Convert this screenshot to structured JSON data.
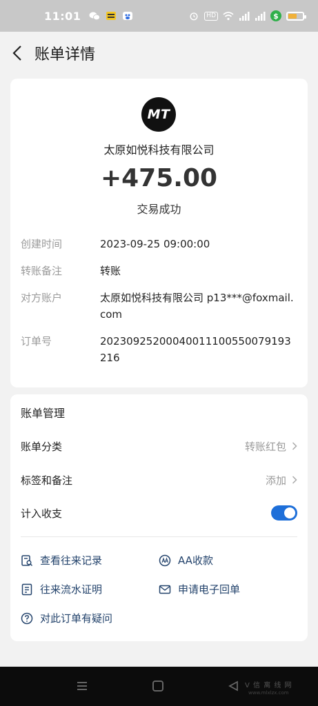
{
  "status_bar": {
    "time": "11:01",
    "left_icons": [
      "wechat-icon",
      "app-badge-icon",
      "baidu-icon"
    ],
    "right_icons": [
      "alarm-icon",
      "hd-icon",
      "wifi-icon",
      "signal-icon",
      "signal-icon",
      "dollar-badge-icon",
      "battery-icon"
    ],
    "hd_label": "HD",
    "dollar_symbol": "$"
  },
  "header": {
    "title": "账单详情"
  },
  "detail": {
    "logo_text": "MT",
    "merchant_name": "太原如悦科技有限公司",
    "amount": "+475.00",
    "status": "交易成功",
    "rows": [
      {
        "label": "创建时间",
        "value": "2023-09-25 09:00:00"
      },
      {
        "label": "转账备注",
        "value": "转账"
      },
      {
        "label": "对方账户",
        "value": "太原如悦科技有限公司 p13***@foxmail.com"
      },
      {
        "label": "订单号",
        "value": "20230925200040011100550079193216"
      }
    ]
  },
  "manage": {
    "title": "账单管理",
    "category_label": "账单分类",
    "category_value": "转账红包",
    "tags_label": "标签和备注",
    "tags_value": "添加",
    "include_label": "计入收支",
    "include_enabled": true,
    "actions": {
      "history": "查看往来记录",
      "aa": "AA收款",
      "proof": "往来流水证明",
      "receipt": "申请电子回单",
      "question": "对此订单有疑问"
    }
  },
  "watermark": {
    "text": "V 信 离 线 网",
    "sub": "www.mlxlzx.com"
  },
  "colors": {
    "accent": "#1e6fd9",
    "action_text": "#22426b",
    "status_bar": "#c8c8c8",
    "background": "#f2f2f2"
  }
}
